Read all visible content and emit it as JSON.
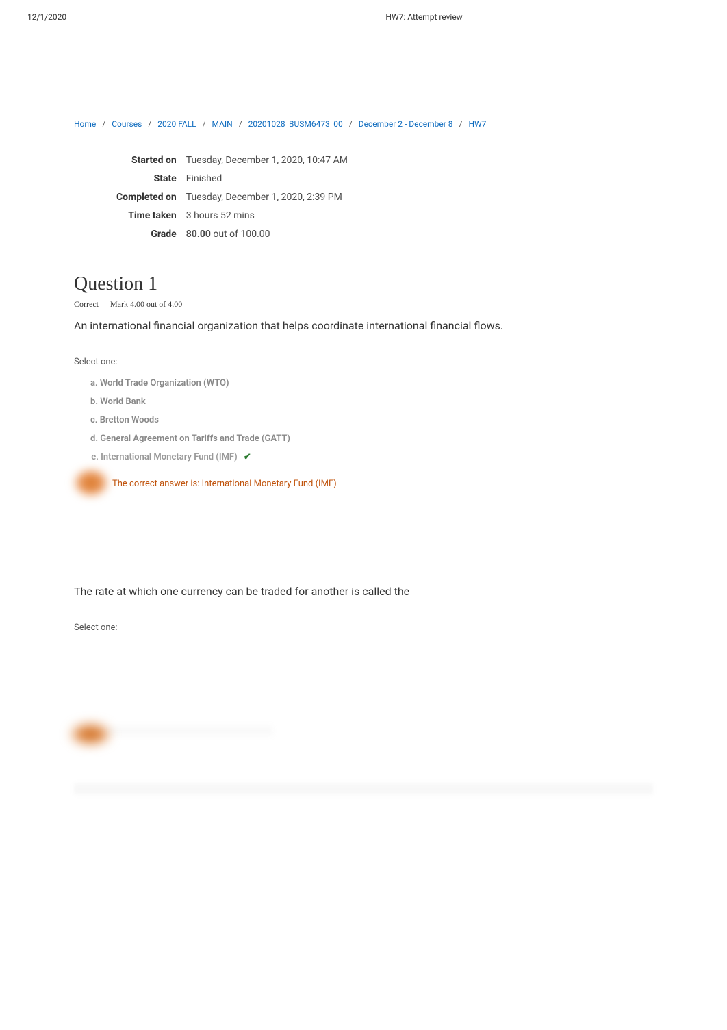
{
  "header": {
    "date": "12/1/2020",
    "title": "HW7: Attempt review"
  },
  "breadcrumb": {
    "items": [
      {
        "label": "Home"
      },
      {
        "label": "Courses"
      },
      {
        "label": "2020 FALL"
      },
      {
        "label": "MAIN"
      },
      {
        "label": "20201028_BUSM6473_00"
      },
      {
        "label": "December 2 - December 8"
      },
      {
        "label": "HW7"
      }
    ]
  },
  "summary": {
    "rows": [
      {
        "label": "Started on",
        "value": "Tuesday, December 1, 2020, 10:47 AM"
      },
      {
        "label": "State",
        "value": "Finished"
      },
      {
        "label": "Completed on",
        "value": "Tuesday, December 1, 2020, 2:39 PM"
      },
      {
        "label": "Time taken",
        "value": "3 hours 52 mins"
      }
    ],
    "grade_label": "Grade",
    "grade_value": "80.00",
    "grade_suffix": " out of 100.00"
  },
  "question1": {
    "title": "Question 1",
    "status": "Correct",
    "mark": "Mark 4.00 out of 4.00",
    "text": "An international financial organization that helps coordinate international financial flows.",
    "select_label": "Select one:",
    "options": [
      {
        "key": "a.",
        "text": "World Trade Organization (WTO)",
        "selected": false
      },
      {
        "key": "b.",
        "text": "World Bank",
        "selected": false
      },
      {
        "key": "c.",
        "text": "Bretton Woods",
        "selected": false
      },
      {
        "key": "d.",
        "text": "General Agreement on Tariffs and Trade (GATT)",
        "selected": false
      },
      {
        "key": "e.",
        "text": "International Monetary Fund (IMF)",
        "selected": true
      }
    ],
    "correct_prefix": "The correct answer is: ",
    "correct_answer": "International Monetary Fund (IMF)"
  },
  "question2": {
    "text": "The rate at which one currency can be traded for another is called the",
    "select_label": "Select one:"
  }
}
